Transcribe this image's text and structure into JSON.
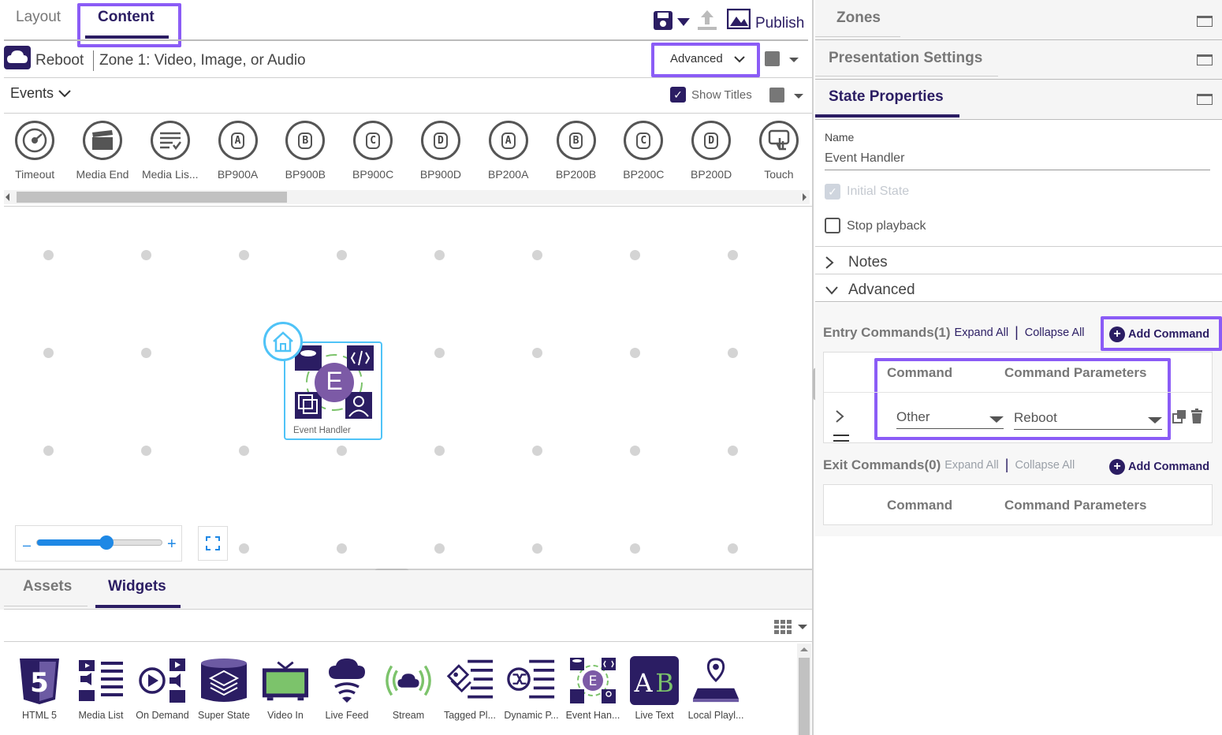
{
  "top_tabs": {
    "layout": "Layout",
    "content": "Content"
  },
  "publish_label": "Publish",
  "breadcrumb": {
    "presentation": "Reboot",
    "zone": "Zone 1: Video, Image, or Audio"
  },
  "mode_select": "Advanced",
  "events_label": "Events",
  "show_titles_label": "Show Titles",
  "event_toolbar": [
    {
      "label": "Timeout",
      "icon": "timer-icon",
      "glyph": ""
    },
    {
      "label": "Media End",
      "icon": "clapperboard-icon",
      "glyph": ""
    },
    {
      "label": "Media Lis...",
      "icon": "media-list-icon",
      "glyph": ""
    },
    {
      "label": "BP900A",
      "icon": "bp900a-icon",
      "glyph": "A"
    },
    {
      "label": "BP900B",
      "icon": "bp900b-icon",
      "glyph": "B"
    },
    {
      "label": "BP900C",
      "icon": "bp900c-icon",
      "glyph": "C"
    },
    {
      "label": "BP900D",
      "icon": "bp900d-icon",
      "glyph": "D"
    },
    {
      "label": "BP200A",
      "icon": "bp200a-icon",
      "glyph": "A"
    },
    {
      "label": "BP200B",
      "icon": "bp200b-icon",
      "glyph": "B"
    },
    {
      "label": "BP200C",
      "icon": "bp200c-icon",
      "glyph": "C"
    },
    {
      "label": "BP200D",
      "icon": "bp200d-icon",
      "glyph": "D"
    },
    {
      "label": "Touch",
      "icon": "touch-icon",
      "glyph": ""
    }
  ],
  "canvas_node": {
    "label": "Event Handler",
    "letter": "E"
  },
  "zoom_level": 0.55,
  "bottom_tabs": {
    "assets": "Assets",
    "widgets": "Widgets"
  },
  "widgets": [
    {
      "label": "HTML 5",
      "icon": "html5-icon"
    },
    {
      "label": "Media List",
      "icon": "media-list-icon"
    },
    {
      "label": "On Demand",
      "icon": "on-demand-icon"
    },
    {
      "label": "Super State",
      "icon": "super-state-icon"
    },
    {
      "label": "Video In",
      "icon": "video-in-icon"
    },
    {
      "label": "Live Feed",
      "icon": "live-feed-icon"
    },
    {
      "label": "Stream",
      "icon": "stream-icon"
    },
    {
      "label": "Tagged Pl...",
      "icon": "tagged-playlist-icon"
    },
    {
      "label": "Dynamic P...",
      "icon": "dynamic-playlist-icon"
    },
    {
      "label": "Event Han...",
      "icon": "event-handler-icon"
    },
    {
      "label": "Live Text",
      "icon": "live-text-icon"
    },
    {
      "label": "Local Playl...",
      "icon": "local-playlist-icon"
    }
  ],
  "right_panel": {
    "zones": "Zones",
    "presentation_settings": "Presentation Settings",
    "state_properties": "State Properties",
    "name_label": "Name",
    "name_value": "Event Handler",
    "initial_state": "Initial State",
    "stop_playback": "Stop playback",
    "notes": "Notes",
    "advanced": "Advanced",
    "entry_commands": "Entry Commands(1)",
    "exit_commands": "Exit Commands(0)",
    "expand_all": "Expand All",
    "collapse_all": "Collapse All",
    "add_command": "Add Command",
    "col_command": "Command",
    "col_params": "Command Parameters",
    "entry_row": {
      "command": "Other",
      "parameter": "Reboot"
    }
  },
  "colors": {
    "brand": "#2b1d63",
    "highlight": "#8b5cf6",
    "node_border": "#4fc3f7"
  }
}
